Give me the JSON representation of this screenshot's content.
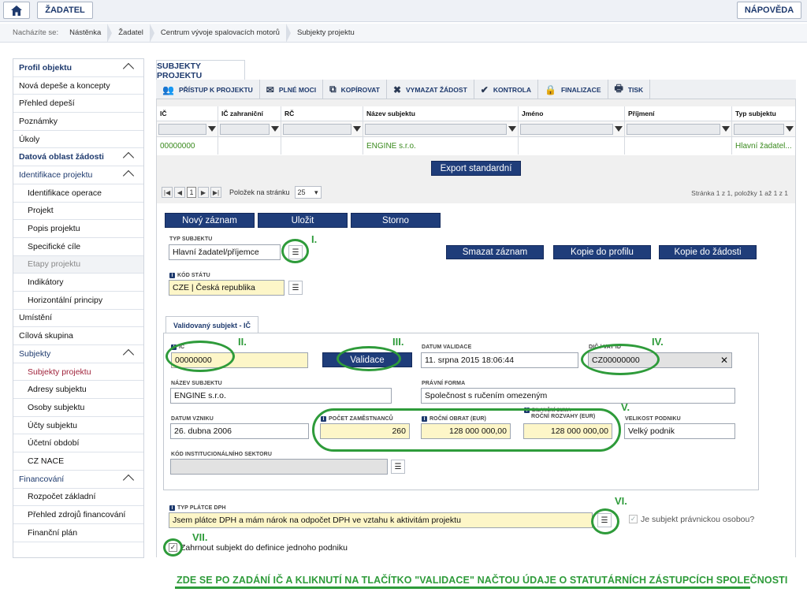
{
  "topbar": {
    "app_title": "ŽADATEL",
    "help": "NÁPOVĚDA"
  },
  "breadcrumb": {
    "label": "Nacházíte se:",
    "items": [
      "Nástěnka",
      "Žadatel",
      "Centrum vývoje spalovacích motorů",
      "Subjekty projektu"
    ]
  },
  "sidebar": {
    "items": [
      {
        "label": "Profil objektu",
        "kind": "head"
      },
      {
        "label": "Nová depeše a koncepty"
      },
      {
        "label": "Přehled depeší"
      },
      {
        "label": "Poznámky"
      },
      {
        "label": "Úkoly"
      },
      {
        "label": "Datová oblast žádosti",
        "kind": "head"
      },
      {
        "label": "Identifikace projektu",
        "kind": "grp"
      },
      {
        "label": "Identifikace operace",
        "kind": "sub"
      },
      {
        "label": "Projekt",
        "kind": "sub"
      },
      {
        "label": "Popis projektu",
        "kind": "sub"
      },
      {
        "label": "Specifické cíle",
        "kind": "sub"
      },
      {
        "label": "Etapy projektu",
        "kind": "sub-muted"
      },
      {
        "label": "Indikátory",
        "kind": "sub"
      },
      {
        "label": "Horizontální principy",
        "kind": "sub"
      },
      {
        "label": "Umístění"
      },
      {
        "label": "Cílová skupina"
      },
      {
        "label": "Subjekty",
        "kind": "grp"
      },
      {
        "label": "Subjekty projektu",
        "kind": "sub-active"
      },
      {
        "label": "Adresy subjektu",
        "kind": "sub"
      },
      {
        "label": "Osoby subjektu",
        "kind": "sub"
      },
      {
        "label": "Účty subjektu",
        "kind": "sub"
      },
      {
        "label": "Účetní období",
        "kind": "sub"
      },
      {
        "label": "CZ NACE",
        "kind": "sub"
      },
      {
        "label": "Financování",
        "kind": "grp"
      },
      {
        "label": "Rozpočet základní",
        "kind": "sub"
      },
      {
        "label": "Přehled zdrojů financování",
        "kind": "sub"
      },
      {
        "label": "Finanční plán",
        "kind": "sub"
      }
    ]
  },
  "main": {
    "tab": "SUBJEKTY PROJEKTU",
    "toolbar": [
      {
        "label": "PŘÍSTUP K PROJEKTU",
        "icon": "people-icon",
        "glyph": "👥"
      },
      {
        "label": "PLNÉ MOCI",
        "icon": "mail-icon",
        "glyph": "✉"
      },
      {
        "label": "KOPÍROVAT",
        "icon": "copy-icon",
        "glyph": "⧉"
      },
      {
        "label": "VYMAZAT ŽÁDOST",
        "icon": "delete-icon",
        "glyph": "✖"
      },
      {
        "label": "KONTROLA",
        "icon": "check-icon",
        "glyph": "✔"
      },
      {
        "label": "FINALIZACE",
        "icon": "lock-icon",
        "glyph": "🔒"
      },
      {
        "label": "TISK",
        "icon": "print-icon",
        "glyph": "🖶"
      }
    ],
    "grid": {
      "columns": [
        "IČ",
        "IČ zahraniční",
        "RČ",
        "Název subjektu",
        "Jméno",
        "Příjmení",
        "Typ subjektu"
      ],
      "rows": [
        [
          "00000000",
          "",
          "",
          "ENGINE s.r.o.",
          "",
          "",
          "Hlavní žadatel..."
        ]
      ]
    },
    "export_label": "Export standardní",
    "pager": {
      "page": "1",
      "per_page_label": "Položek na stránku",
      "per_page": "25",
      "info": "Stránka 1 z 1, položky 1 až 1 z 1"
    },
    "buttons": {
      "new": "Nový záznam",
      "save": "Uložit",
      "cancel": "Storno",
      "delete": "Smazat záznam",
      "copy_profile": "Kopie do profilu",
      "copy_request": "Kopie do žádosti"
    },
    "form": {
      "typ_subjektu_label": "TYP SUBJEKTU",
      "typ_subjektu": "Hlavní žadatel/příjemce",
      "kod_statu_label": "KÓD STÁTU",
      "kod_statu": "CZE | Česká republika",
      "subtab": "Validovaný subjekt - IČ",
      "ic_label": "IČ",
      "ic": "00000000",
      "validace": "Validace",
      "datum_validace_label": "DATUM VALIDACE",
      "datum_validace": "11. srpna 2015 18:06:44",
      "dic_label": "DIČ / VAT ID",
      "dic": "CZ00000000",
      "nazev_label": "NÁZEV SUBJEKTU",
      "nazev": "ENGINE s.r.o.",
      "pravni_forma_label": "PRÁVNÍ FORMA",
      "pravni_forma": "Společnost s ručením omezeným",
      "datum_vzniku_label": "DATUM VZNIKU",
      "datum_vzniku": "26. dubna 2006",
      "pocet_label": "POČET ZAMĚSTNANCŮ",
      "pocet": "260",
      "obrat_label": "ROČNÍ OBRAT (EUR)",
      "obrat": "128 000 000,00",
      "bilancni_label_top": "BILANČNÍ SUMA",
      "bilancni_label": "ROČNÍ ROZVAHY (EUR)",
      "bilancni": "128 000 000,00",
      "velikost_label": "VELIKOST PODNIKU",
      "velikost": "Velký podnik",
      "kod_sektoru_label": "KÓD INSTITUCIONÁLNÍHO SEKTORU",
      "typ_platce_label": "TYP PLÁTCE DPH",
      "typ_platce": "Jsem plátce DPH a mám nárok na odpočet DPH ve vztahu k aktivitám projektu",
      "pravnicka_label": "Je subjekt právnickou osobou?",
      "zahrnout_label": "Zahrnout subjekt do definice jednoho podniku"
    },
    "annotations": [
      "I.",
      "II.",
      "III.",
      "IV.",
      "V.",
      "VI.",
      "VII."
    ]
  },
  "footer_note": "ZDE SE PO ZADÁNÍ IČ A KLIKNUTÍ NA TLAČÍTKO \"VALIDACE\" NAČTOU ÚDAJE O STATUTÁRNÍCH ZÁSTUPCÍCH SPOLEČNOSTI",
  "colors": {
    "accent": "#1f3d7a",
    "annotation": "#2e9b3a",
    "required_bg": "#fdf6c8",
    "active_item": "#a0243c"
  }
}
